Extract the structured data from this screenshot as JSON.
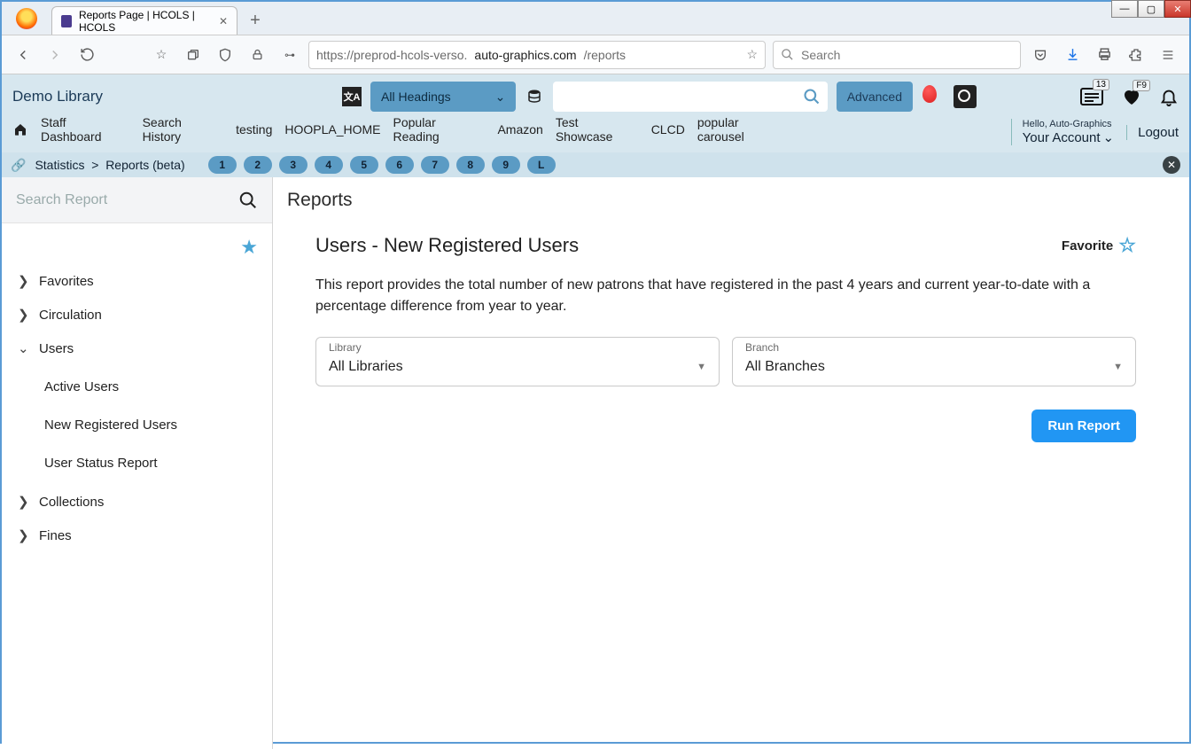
{
  "window": {
    "tab_title": "Reports Page | HCOLS | HCOLS"
  },
  "url": {
    "prefix": "https://preprod-hcols-verso.",
    "domain": "auto-graphics.com",
    "suffix": "/reports"
  },
  "browser_search_placeholder": "Search",
  "library_title": "Demo Library",
  "headings_dropdown": "All Headings",
  "advanced_label": "Advanced",
  "badges": {
    "list": "13",
    "heart": "F9"
  },
  "account": {
    "hello": "Hello, Auto-Graphics",
    "label": "Your Account"
  },
  "logout": "Logout",
  "nav_links": [
    "Staff Dashboard",
    "Search History",
    "testing",
    "HOOPLA_HOME",
    "Popular Reading",
    "Amazon",
    "Test Showcase",
    "CLCD",
    "popular carousel"
  ],
  "breadcrumb": {
    "a": "Statistics",
    "b": "Reports (beta)"
  },
  "pills": [
    "1",
    "2",
    "3",
    "4",
    "5",
    "6",
    "7",
    "8",
    "9",
    "L"
  ],
  "side_search_placeholder": "Search Report",
  "tree": {
    "favorites": "Favorites",
    "circulation": "Circulation",
    "users": "Users",
    "users_children": [
      "Active Users",
      "New Registered Users",
      "User Status Report"
    ],
    "collections": "Collections",
    "fines": "Fines"
  },
  "page_title": "Reports",
  "report": {
    "title": "Users - New Registered Users",
    "favorite_label": "Favorite",
    "description": "This report provides the total number of new patrons that have registered in the past 4 years and current year-to-date with a percentage difference from year to year.",
    "library_label": "Library",
    "library_value": "All Libraries",
    "branch_label": "Branch",
    "branch_value": "All Branches",
    "run_label": "Run Report"
  }
}
